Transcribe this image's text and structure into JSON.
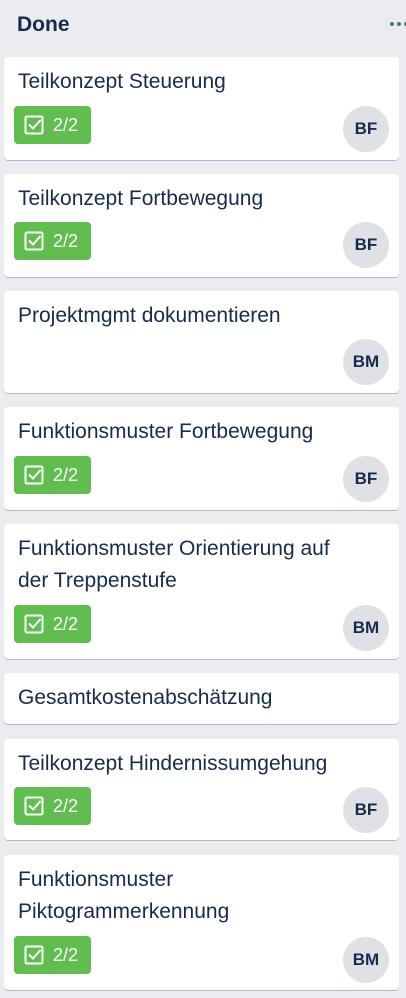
{
  "list": {
    "title": "Done",
    "menu_icon": "ellipsis-icon"
  },
  "cards": [
    {
      "title": "Teilkonzept Steuerung",
      "checklist": "2/2",
      "member": "BF"
    },
    {
      "title": "Teilkonzept Fortbewegung",
      "checklist": "2/2",
      "member": "BF"
    },
    {
      "title": "Projektmgmt dokumentieren",
      "checklist": null,
      "member": "BM"
    },
    {
      "title": "Funktionsmuster Fortbewegung",
      "checklist": "2/2",
      "member": "BF"
    },
    {
      "title": "Funktionsmuster Orientierung auf der Treppenstufe",
      "checklist": "2/2",
      "member": "BM"
    },
    {
      "title": "Gesamtkostenabschätzung",
      "checklist": null,
      "member": null
    },
    {
      "title": "Teilkonzept Hindernissumgehung",
      "checklist": "2/2",
      "member": "BF"
    },
    {
      "title": "Funktionsmuster Piktogrammerkennung",
      "checklist": "2/2",
      "member": "BM"
    }
  ],
  "colors": {
    "list_background": "#ebecf0",
    "card_background": "#ffffff",
    "checklist_complete": "#61bd4f",
    "avatar_background": "#dfe1e6",
    "text": "#172b4d"
  }
}
